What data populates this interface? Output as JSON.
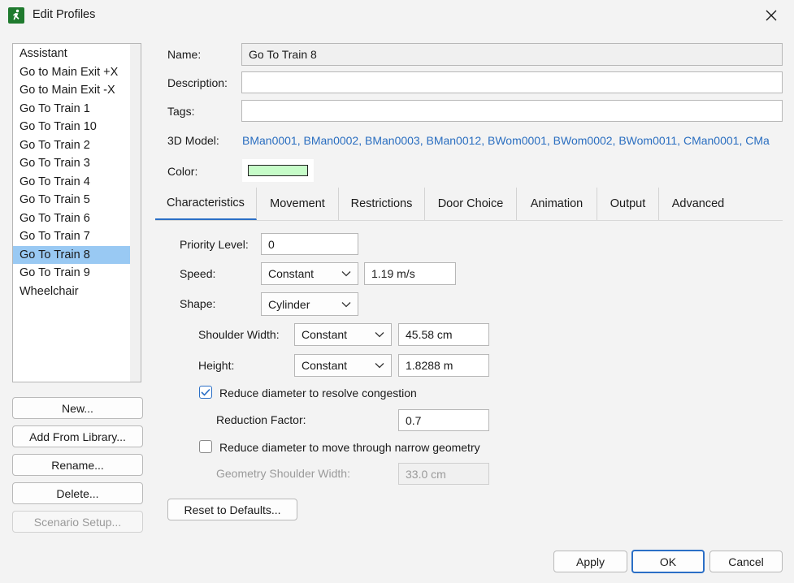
{
  "window": {
    "title": "Edit Profiles"
  },
  "profiles": {
    "items": [
      "Assistant",
      "Go to Main Exit +X",
      "Go to Main Exit -X",
      "Go To Train 1",
      "Go To Train 10",
      "Go To Train 2",
      "Go To Train 3",
      "Go To Train 4",
      "Go To Train 5",
      "Go To Train 6",
      "Go To Train 7",
      "Go To Train 8",
      "Go To Train 9",
      "Wheelchair"
    ],
    "selected": "Go To Train 8"
  },
  "left_buttons": {
    "new": "New...",
    "add_from_library": "Add From Library...",
    "rename": "Rename...",
    "delete": "Delete...",
    "scenario_setup": "Scenario Setup..."
  },
  "form": {
    "name_label": "Name:",
    "name_value": "Go To Train 8",
    "description_label": "Description:",
    "description_value": "",
    "tags_label": "Tags:",
    "tags_value": "",
    "model_label": "3D Model:",
    "model_value": "BMan0001, BMan0002, BMan0003, BMan0012, BWom0001, BWom0002, BWom0011, CMan0001, CMa",
    "color_label": "Color:",
    "color_value": "#c6fcc8"
  },
  "tabs": [
    "Characteristics",
    "Movement",
    "Restrictions",
    "Door Choice",
    "Animation",
    "Output",
    "Advanced"
  ],
  "active_tab": "Characteristics",
  "characteristics": {
    "priority_label": "Priority Level:",
    "priority_value": "0",
    "speed_label": "Speed:",
    "speed_mode": "Constant",
    "speed_value": "1.19 m/s",
    "shape_label": "Shape:",
    "shape_value": "Cylinder",
    "shoulder_label": "Shoulder Width:",
    "shoulder_mode": "Constant",
    "shoulder_value": "45.58 cm",
    "height_label": "Height:",
    "height_mode": "Constant",
    "height_value": "1.8288 m",
    "reduce_congestion_label": "Reduce diameter to resolve congestion",
    "reduce_congestion_checked": true,
    "reduction_factor_label": "Reduction Factor:",
    "reduction_factor_value": "0.7",
    "reduce_narrow_label": "Reduce diameter to move through narrow geometry",
    "reduce_narrow_checked": false,
    "geometry_shoulder_label": "Geometry Shoulder Width:",
    "geometry_shoulder_value": "33.0 cm",
    "reset_label": "Reset to Defaults..."
  },
  "footer": {
    "apply": "Apply",
    "ok": "OK",
    "cancel": "Cancel"
  },
  "colors": {
    "accent": "#2b6fc6",
    "selection": "#99c9f3",
    "link": "#2a6ec0",
    "app_icon": "#1f7a2e"
  }
}
